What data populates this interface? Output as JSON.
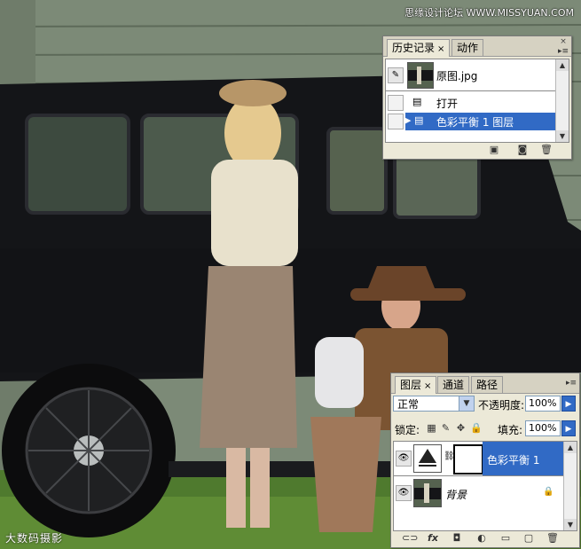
{
  "watermark": "思缘设计论坛 WWW.MISSYUAN.COM",
  "bottom_logo": "大数码摄影",
  "history_panel": {
    "tabs": [
      "历史记录",
      "动作"
    ],
    "snapshot_label": "原图.jpg",
    "items": [
      {
        "label": "打开",
        "selected": false
      },
      {
        "label": "色彩平衡 1 图层",
        "selected": true
      }
    ],
    "bottom_icons": [
      "new-document-from-state-icon",
      "snapshot-camera-icon",
      "trash-icon"
    ]
  },
  "layers_panel": {
    "tabs": [
      "图层",
      "通道",
      "路径"
    ],
    "blend_mode": "正常",
    "opacity_label": "不透明度:",
    "opacity_value": "100%",
    "lock_label": "锁定:",
    "fill_label": "填充:",
    "fill_value": "100%",
    "layers": [
      {
        "name": "色彩平衡 1",
        "selected": true,
        "type": "adjustment"
      },
      {
        "name": "背景",
        "selected": false,
        "type": "background",
        "locked": true
      }
    ],
    "bottom_icons": [
      "link-icon",
      "fx-icon",
      "mask-icon",
      "adjustment-icon",
      "folder-icon",
      "new-layer-icon",
      "trash-icon"
    ]
  },
  "colors": {
    "selection": "#316ac5",
    "panel_bg": "#ece9d8"
  }
}
